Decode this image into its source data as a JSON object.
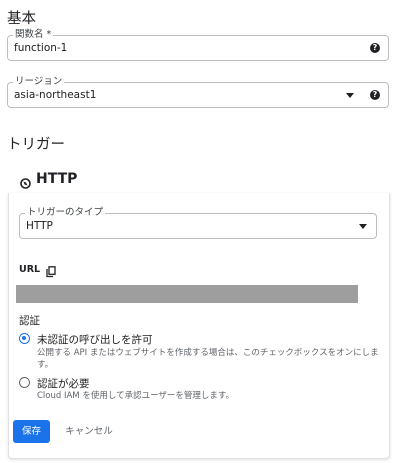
{
  "basic": {
    "title": "基本",
    "function_name": {
      "label": "関数名 *",
      "value": "function-1",
      "help_icon": "help-icon"
    },
    "region": {
      "label": "リージョン",
      "value": "asia-northeast1",
      "help_icon": "help-icon"
    }
  },
  "trigger": {
    "title": "トリガー",
    "card_title": "HTTP",
    "card_icon": "globe-icon",
    "type_select": {
      "label": "トリガーのタイプ",
      "value": "HTTP"
    },
    "url": {
      "label": "URL",
      "copy_icon": "copy-icon",
      "value_redacted": true
    },
    "auth": {
      "title": "認証",
      "options": [
        {
          "label": "未認証の呼び出しを許可",
          "description": "公開する API またはウェブサイトを作成する場合は、このチェックボックスをオンにします。",
          "checked": true
        },
        {
          "label": "認証が必要",
          "description": "Cloud IAM を使用して承認ユーザーを管理します。",
          "checked": false
        }
      ]
    },
    "save_label": "保存",
    "cancel_label": "キャンセル"
  },
  "colors": {
    "primary": "#1a73e8",
    "redacted": "#9e9e9e",
    "text": "#202124",
    "secondary_text": "#5f6368"
  }
}
